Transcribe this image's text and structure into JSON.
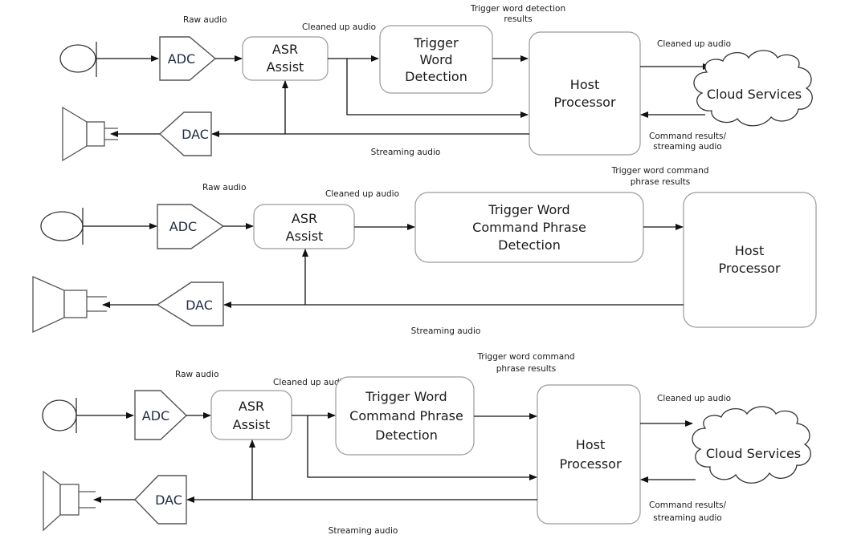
{
  "diagram": {
    "panels": [
      {
        "id": "panel-1",
        "labels": {
          "raw_audio": "Raw audio",
          "cleaned_up_audio_1": "Cleaned up audio",
          "detection_results_1": "Trigger word detection",
          "detection_results_2": "results",
          "cleaned_up_audio_2": "Cleaned up audio",
          "command_results_1": "Command results/",
          "command_results_2": "streaming audio",
          "streaming_audio": "Streaming audio"
        },
        "blocks": {
          "adc": "ADC",
          "dac": "DAC",
          "asr_1": "ASR",
          "asr_2": "Assist",
          "detect_1": "Trigger",
          "detect_2": "Word",
          "detect_3": "Detection",
          "host_1": "Host",
          "host_2": "Processor",
          "cloud": "Cloud Services"
        }
      },
      {
        "id": "panel-2",
        "labels": {
          "raw_audio": "Raw audio",
          "cleaned_up_audio_1": "Cleaned up audio",
          "detection_results_1": "Trigger word command",
          "detection_results_2": "phrase results",
          "streaming_audio": "Streaming audio"
        },
        "blocks": {
          "adc": "ADC",
          "dac": "DAC",
          "asr_1": "ASR",
          "asr_2": "Assist",
          "detect_1": "Trigger Word",
          "detect_2": "Command Phrase",
          "detect_3": "Detection",
          "host_1": "Host",
          "host_2": "Processor"
        }
      },
      {
        "id": "panel-3",
        "labels": {
          "raw_audio": "Raw audio",
          "cleaned_up_audio_1": "Cleaned up audio",
          "detection_results_1": "Trigger word command",
          "detection_results_2": "phrase results",
          "cleaned_up_audio_2": "Cleaned up audio",
          "command_results_1": "Command results/",
          "command_results_2": "streaming audio",
          "streaming_audio": "Streaming audio"
        },
        "blocks": {
          "adc": "ADC",
          "dac": "DAC",
          "asr_1": "ASR",
          "asr_2": "Assist",
          "detect_1": "Trigger Word",
          "detect_2": "Command Phrase",
          "detect_3": "Detection",
          "host_1": "Host",
          "host_2": "Processor",
          "cloud": "Cloud Services"
        }
      }
    ]
  }
}
